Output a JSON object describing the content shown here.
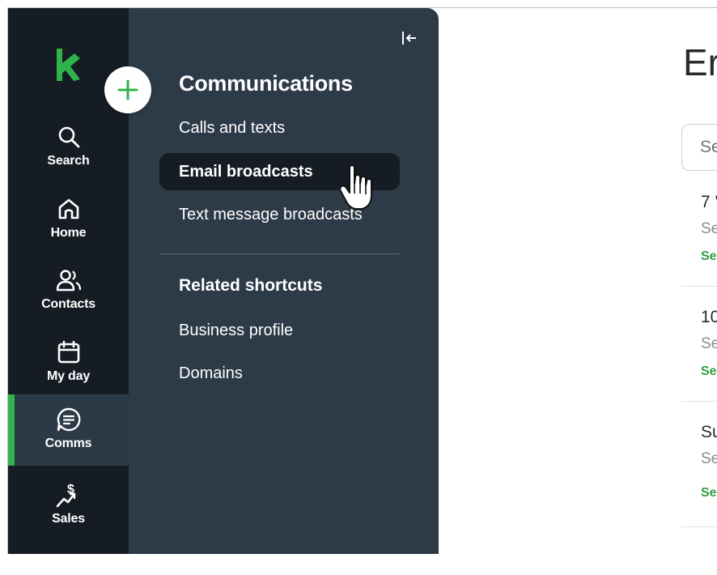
{
  "colors": {
    "rail_bg": "#151c23",
    "panel_bg": "#2d3a48",
    "accent_green": "#2fb34a",
    "text_white": "#ffffff"
  },
  "rail": {
    "logo_icon": "keap-logo-icon",
    "add_icon": "plus-icon",
    "items": [
      {
        "label": "Search",
        "icon": "search-icon"
      },
      {
        "label": "Home",
        "icon": "home-icon"
      },
      {
        "label": "Contacts",
        "icon": "contacts-icon"
      },
      {
        "label": "My day",
        "icon": "calendar-icon"
      },
      {
        "label": "Comms",
        "icon": "chat-icon",
        "active": true
      },
      {
        "label": "Sales",
        "icon": "sales-icon"
      }
    ]
  },
  "panel": {
    "title": "Communications",
    "collapse_icon": "collapse-left-icon",
    "items": [
      {
        "label": "Calls and texts"
      },
      {
        "label": "Email broadcasts",
        "selected": true
      },
      {
        "label": "Text message broadcasts"
      }
    ],
    "related_title": "Related shortcuts",
    "related_items": [
      {
        "label": "Business profile"
      },
      {
        "label": "Domains"
      }
    ]
  },
  "content": {
    "page_title": "Er",
    "search_placeholder": "Se",
    "rows": [
      {
        "title": "7 '",
        "subtitle": "Se",
        "status": "Se"
      },
      {
        "title": "10",
        "subtitle": "Se",
        "status": "Se"
      },
      {
        "title": "Su",
        "subtitle": "Se",
        "status": "Se"
      }
    ]
  }
}
